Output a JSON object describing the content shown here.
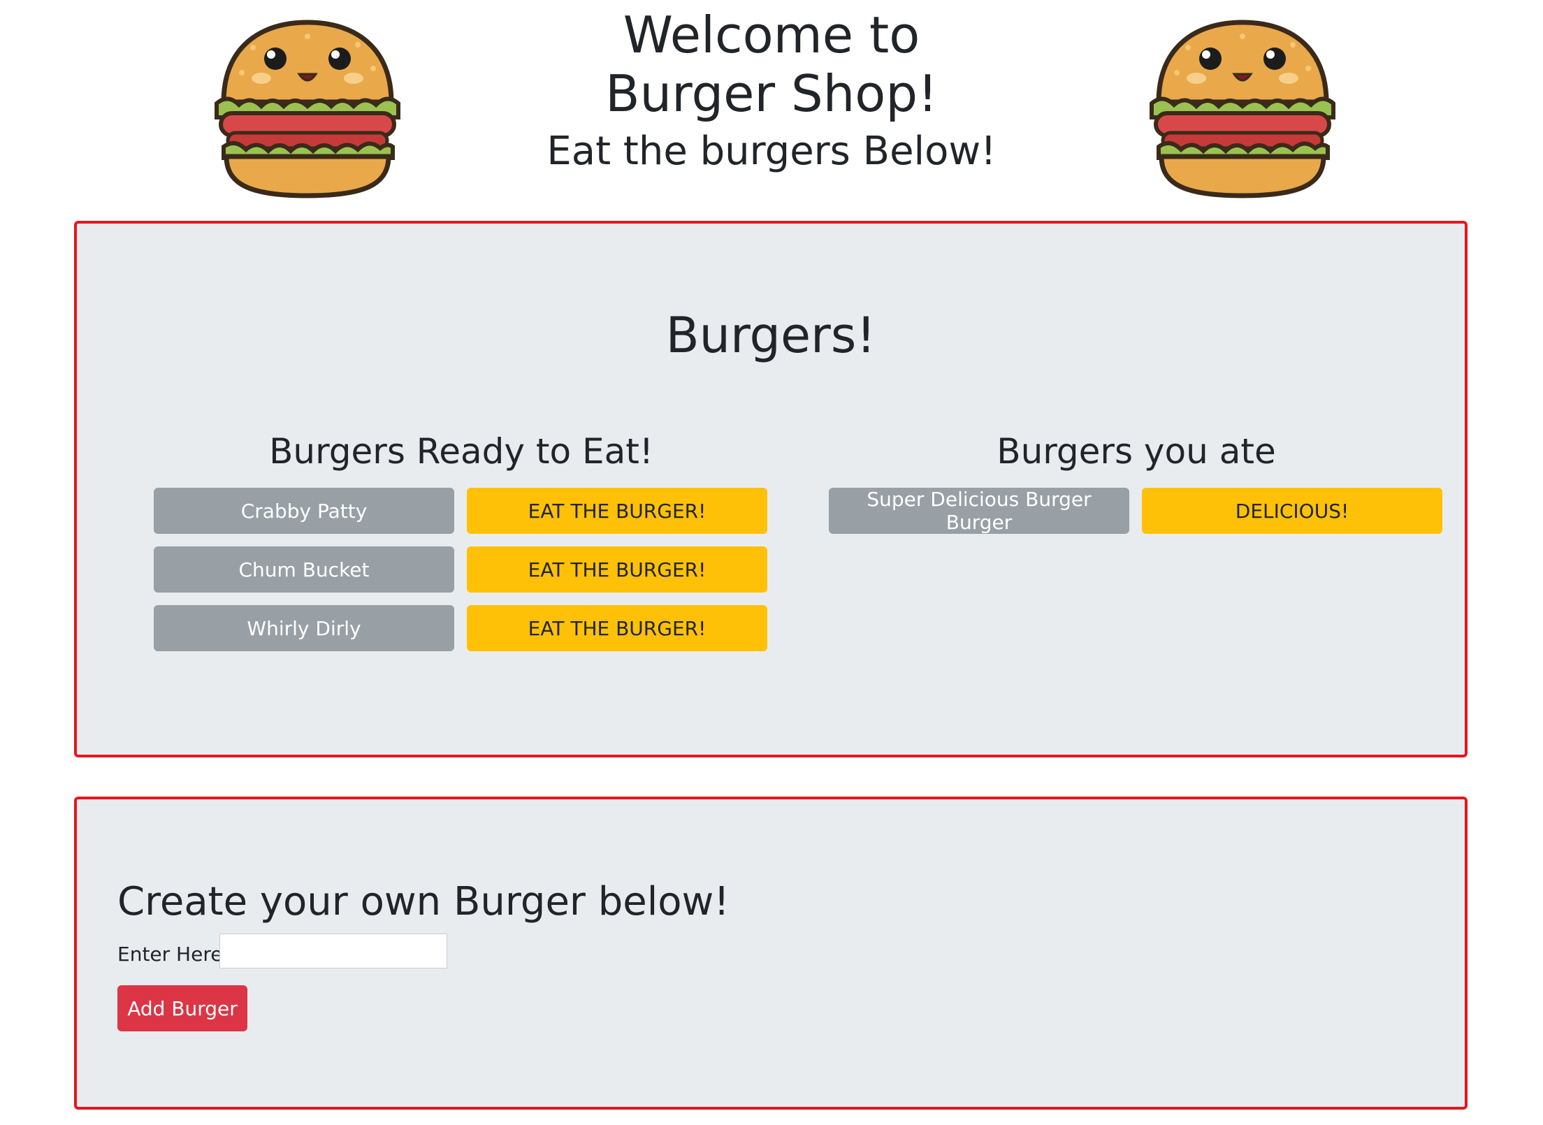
{
  "header": {
    "title_line1": "Welcome to",
    "title_line2": "Burger Shop!",
    "subtitle": "Eat the burgers Below!",
    "mascot_icon": "burger-mascot-icon"
  },
  "burgers_panel": {
    "title": "Burgers!",
    "ready_title": "Burgers Ready to Eat!",
    "eaten_title": "Burgers you ate",
    "ready": [
      {
        "name": "Crabby Patty",
        "action": "EAT THE BURGER!"
      },
      {
        "name": "Chum Bucket",
        "action": "EAT THE BURGER!"
      },
      {
        "name": "Whirly Dirly",
        "action": "EAT THE BURGER!"
      }
    ],
    "eaten": [
      {
        "name": "Super Delicious Burger Burger",
        "action": "DELICIOUS!"
      }
    ]
  },
  "create_panel": {
    "title": "Create your own Burger below!",
    "input_label": "Enter Here!",
    "input_value": "",
    "button_label": "Add Burger"
  },
  "colors": {
    "panel_border": "#e6161d",
    "panel_bg": "#e9ecef",
    "name_button": "#98a0a6",
    "eat_button": "#ffc107",
    "add_button": "#dc3545"
  }
}
